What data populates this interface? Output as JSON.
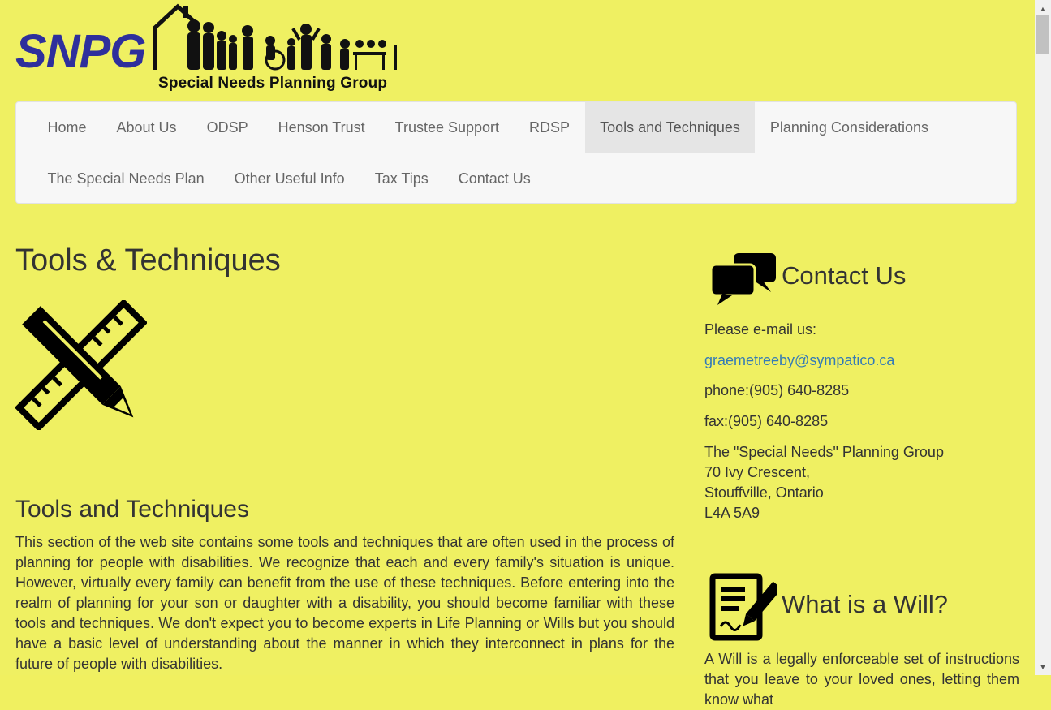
{
  "logo": {
    "text": "SNPG",
    "tagline": "Special Needs Planning Group"
  },
  "nav": {
    "row1": [
      "Home",
      "About Us",
      "ODSP",
      "Henson Trust",
      "Trustee Support",
      "RDSP",
      "Tools and Techniques",
      "Planning Considerations"
    ],
    "row2": [
      "The Special Needs Plan",
      "Other Useful Info",
      "Tax Tips",
      "Contact Us"
    ],
    "active": "Tools and Techniques"
  },
  "main": {
    "title": "Tools & Techniques",
    "section_title": "Tools and Techniques",
    "paragraph": "This section of the web site contains some tools and techniques that are often used in the process of planning for people with disabilities. We recognize that each and every family's situation is unique. However, virtually every family can benefit from the use of these techniques. Before entering into the realm of planning for your son or daughter with a disability, you should become familiar with these tools and techniques. We don't expect you to become experts in Life Planning or Wills but you should have a basic level of understanding about the manner in which they interconnect in plans for the future of people with disabilities."
  },
  "sidebar": {
    "contact_title": "Contact Us",
    "email_prompt": "Please e-mail us:",
    "email": "graemetreeby@sympatico.ca",
    "phone": "phone:(905) 640-8285",
    "fax": "fax:(905) 640-8285",
    "address": [
      "The \"Special Needs\" Planning Group",
      "70 Ivy Crescent,",
      "Stouffville, Ontario",
      "L4A 5A9"
    ],
    "will_title": "What is a Will?",
    "will_text": "A Will is a legally enforceable set of instructions that you leave to your loved ones, letting them know what"
  },
  "colors": {
    "background": "#eff062",
    "link": "#337ab7",
    "logo_blue": "#2e2f9c"
  },
  "icons": [
    "family-logo-icon",
    "ruler-pencil-icon",
    "chat-bubbles-icon",
    "will-document-icon",
    "scroll-up-arrow-icon",
    "scroll-down-arrow-icon"
  ]
}
